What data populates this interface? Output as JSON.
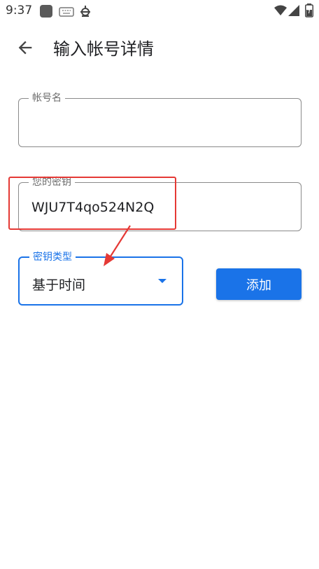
{
  "status_bar": {
    "time": "9:37",
    "left_icons": [
      "app-square-icon",
      "keyboard-icon",
      "bug-icon"
    ],
    "right_icons": [
      "wifi-icon",
      "signal-icon",
      "battery-icon"
    ]
  },
  "app_bar": {
    "title": "输入帐号详情"
  },
  "form": {
    "account_name": {
      "label": "帐号名",
      "value": ""
    },
    "secret_key": {
      "label": "您的密钥",
      "value": "WJU7T4qo524N2Q"
    },
    "key_type": {
      "label": "密钥类型",
      "value": "基于时间"
    },
    "add_button": "添加"
  },
  "colors": {
    "accent": "#1a73e8",
    "annotation": "#e53935"
  }
}
